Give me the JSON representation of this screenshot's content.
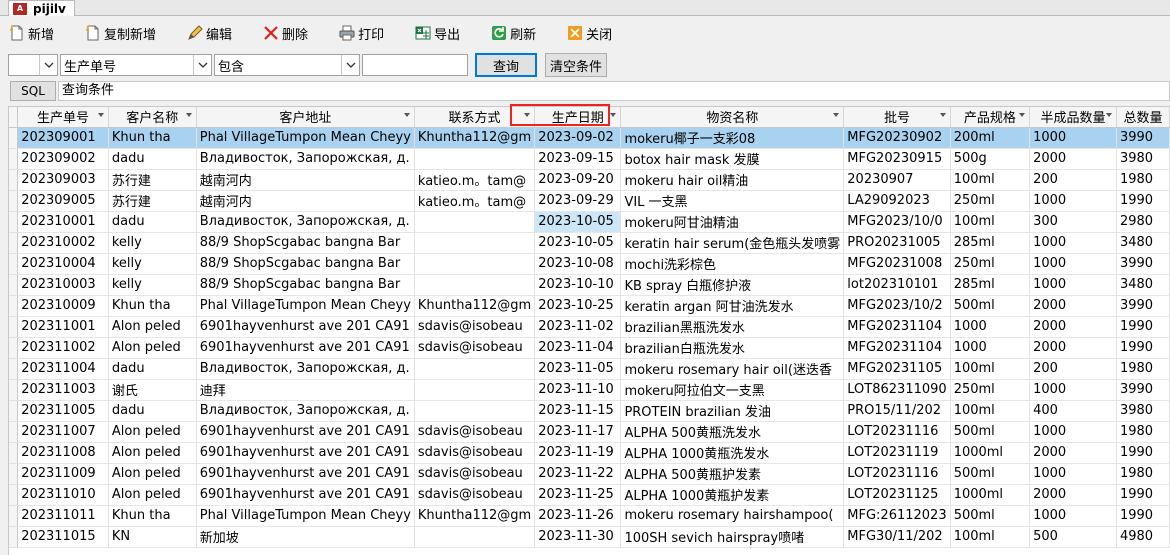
{
  "window": {
    "tab_title": "pijilv",
    "app_icon_text": "A"
  },
  "toolbar": {
    "new": "新增",
    "copy_new": "复制新增",
    "edit": "编辑",
    "delete": "删除",
    "print": "打印",
    "export": "导出",
    "refresh": "刷新",
    "close": "关闭"
  },
  "filter": {
    "combo1": "",
    "field": "生产单号",
    "operator": "包含",
    "value": "",
    "query_button": "查询",
    "clear_button": "清空条件"
  },
  "sql": {
    "button": "SQL",
    "conditions": "查询条件"
  },
  "grid": {
    "columns": [
      "生产单号",
      "客户名称",
      "客户地址",
      "联系方式",
      "生产日期",
      "物资名称",
      "批号",
      "产品规格",
      "半成品数量",
      "总数量"
    ],
    "rows": [
      [
        "202309001",
        "Khun tha",
        "Phal  VillageTumpon Mean Cheyy",
        "Khuntha112@gm",
        "2023-09-02",
        "mokeru椰子一支彩08",
        "MFG20230902",
        "200ml",
        "1000",
        "3990"
      ],
      [
        "202309002",
        "dadu",
        "Владивосток, Запорожская, д.",
        "",
        "2023-09-15",
        "botox hair mask 发膜",
        "MFG20230915",
        "500g",
        "2000",
        "3980"
      ],
      [
        "202309003",
        "苏行建",
        "越南河内",
        "katieo.m。tam@",
        "2023-09-20",
        "mokeru hair oil精油",
        "20230907",
        "100ml",
        "200",
        "1980"
      ],
      [
        "202309005",
        "苏行建",
        "越南河内",
        "katieo.m。tam@",
        "2023-09-29",
        "VIL 一支黑",
        "LA29092023",
        "250ml",
        "1000",
        "1990"
      ],
      [
        "202310001",
        "dadu",
        "Владивосток, Запорожская, д.",
        "",
        "2023-10-05",
        "mokeru阿甘油精油",
        "MFG2023/10/0",
        "100ml",
        "300",
        "2980"
      ],
      [
        "202310002",
        "kelly",
        " 88/9 ShopScgabac bangna Bar",
        "",
        "2023-10-05",
        "keratin hair serum(金色瓶头发喷雾",
        "PRO20231005",
        "285ml",
        "1000",
        "3480"
      ],
      [
        "202310004",
        "kelly",
        " 88/9 ShopScgabac bangna Bar",
        "",
        "2023-10-08",
        "mochi洗彩棕色",
        "MFG20231008",
        "250ml",
        "1000",
        "3990"
      ],
      [
        "202310003",
        "kelly",
        " 88/9 ShopScgabac bangna Bar",
        "",
        "2023-10-10",
        "KB spray 白瓶修护液",
        "lot202310101",
        "285ml",
        "1000",
        "3480"
      ],
      [
        "202310009",
        "Khun tha",
        "Phal  VillageTumpon Mean Cheyy",
        "Khuntha112@gm",
        "2023-10-25",
        "keratin argan 阿甘油洗发水",
        "MFG2023/10/2",
        "500ml",
        "2000",
        "3990"
      ],
      [
        "202311001",
        "Alon peled",
        "6901hayvenhurst ave 201 CA91",
        "sdavis@isobeau",
        "2023-11-02",
        "brazilian黑瓶洗发水",
        "MFG20231104",
        "1000",
        "2000",
        "1990"
      ],
      [
        "202311002",
        "Alon peled",
        "6901hayvenhurst ave 201 CA91",
        "sdavis@isobeau",
        "2023-11-04",
        "brazilian白瓶洗发水",
        "MFG20231104",
        "1000",
        "2000",
        "1990"
      ],
      [
        "202311004",
        "dadu",
        "Владивосток, Запорожская, д.",
        "",
        "2023-11-05",
        "mokeru rosemary hair oil(迷迭香",
        "MFG20231105",
        "100ml",
        "200",
        "1980"
      ],
      [
        "202311003",
        "谢氏",
        "迪拜",
        "",
        "2023-11-10",
        "mokeru阿拉伯文一支黑",
        "LOT862311090",
        "250ml",
        "1000",
        "3990"
      ],
      [
        "202311005",
        "dadu",
        "Владивосток, Запорожская, д.",
        "",
        "2023-11-15",
        "PROTEIN brazilian 发油",
        "PRO15/11/202",
        "100ml",
        "400",
        "3980"
      ],
      [
        "202311007",
        "Alon peled",
        "6901hayvenhurst ave 201 CA91",
        "sdavis@isobeau",
        "2023-11-17",
        "ALPHA 500黄瓶洗发水",
        "LOT20231116",
        "500ml",
        "1000",
        "1980"
      ],
      [
        "202311008",
        "Alon peled",
        "6901hayvenhurst ave 201 CA91",
        "sdavis@isobeau",
        "2023-11-19",
        "ALPHA 1000黄瓶洗发水",
        "LOT20231119",
        "1000ml",
        "2000",
        "1990"
      ],
      [
        "202311009",
        "Alon peled",
        "6901hayvenhurst ave 201 CA91",
        "sdavis@isobeau",
        "2023-11-22",
        "ALPHA 500黄瓶护发素",
        "LOT20231116",
        "500ml",
        "1000",
        "1980"
      ],
      [
        "202311010",
        "Alon peled",
        "6901hayvenhurst ave 201 CA91",
        "sdavis@isobeau",
        "2023-11-25",
        "ALPHA 1000黄瓶护发素",
        "LOT20231125",
        "1000ml",
        "2000",
        "1990"
      ],
      [
        "202311011",
        "Khun tha",
        "Phal  VillageTumpon Mean Cheyy",
        "Khuntha112@gm",
        "2023-11-26",
        "mokeru rosemary hairshampoo(",
        "MFG:26112023",
        "500ml",
        "1000",
        "1990"
      ],
      [
        "202311015",
        "KN",
        "新加坡",
        "",
        "2023-11-30",
        "100SH sevich hairspray喷啫",
        "MFG30/11/202",
        "100ml",
        "500",
        "4980"
      ]
    ]
  }
}
